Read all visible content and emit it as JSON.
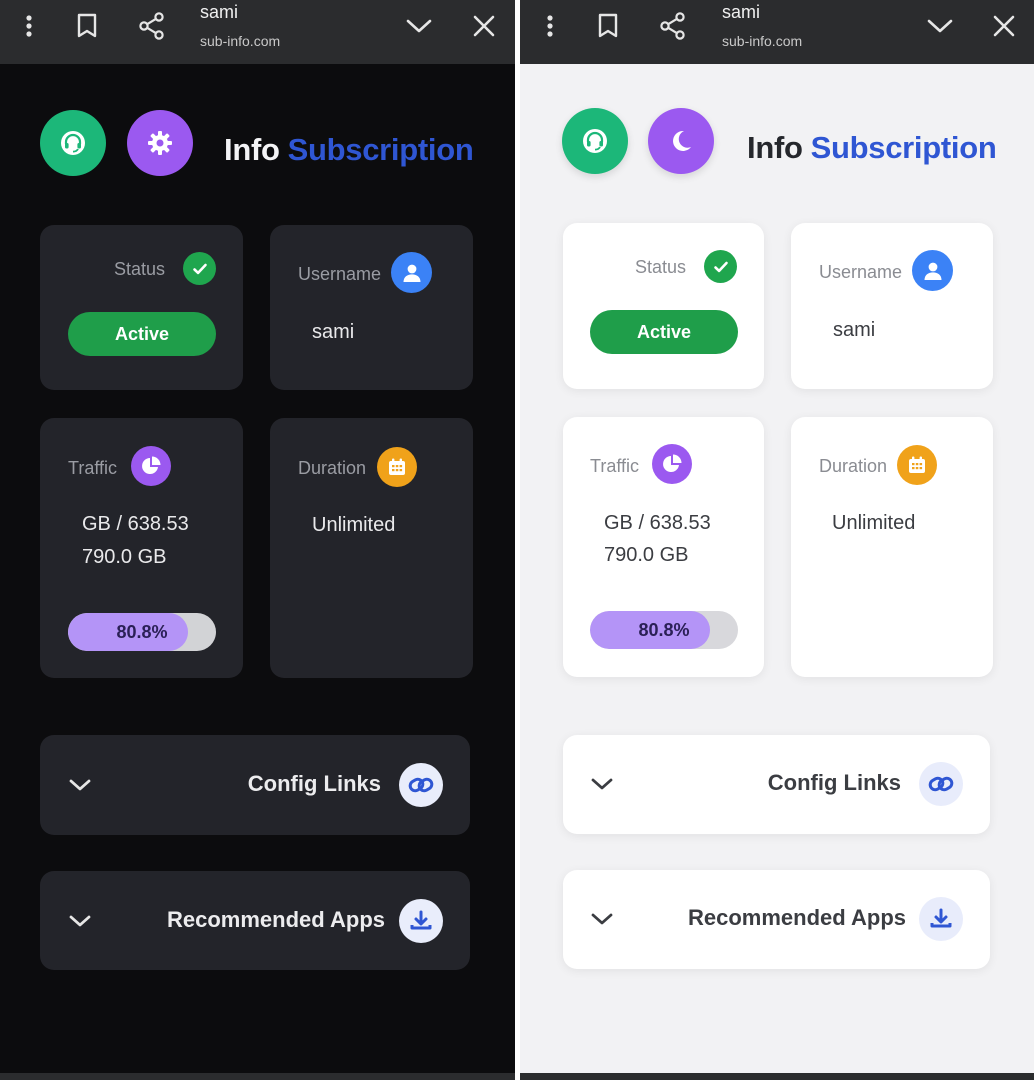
{
  "browser": {
    "title": "sami",
    "url": "sub-info.com"
  },
  "header": {
    "title_word1": "Info",
    "title_word2": "Subscription"
  },
  "status": {
    "label": "Status",
    "value": "Active"
  },
  "username": {
    "label": "Username",
    "value": "sami"
  },
  "traffic": {
    "label": "Traffic",
    "used": "GB / 638.53",
    "total": "790.0 GB",
    "percent_text": "80.8%",
    "percent": 80.8
  },
  "duration": {
    "label": "Duration",
    "value": "Unlimited"
  },
  "sections": {
    "config_links": "Config Links",
    "recommended_apps": "Recommended Apps"
  },
  "icons": {
    "menu": "more-vert-icon",
    "bookmark": "bookmark-icon",
    "share": "share-icon",
    "collapse": "chevron-down-icon",
    "close": "close-icon",
    "support": "headset-icon",
    "settings": "gear-icon",
    "dark_mode": "moon-icon",
    "status": "check-circle-icon",
    "user": "user-icon",
    "traffic": "pie-chart-icon",
    "duration": "calendar-icon",
    "config": "link-icon",
    "apps": "download-icon"
  },
  "colors": {
    "accent_blue": "#2f56d3",
    "green": "#1cb779",
    "purple": "#9b59f0",
    "active_pill": "#1f9e4a",
    "progress_fill": "#b494f7",
    "orange": "#f0a21a",
    "user_blue": "#3b82f6"
  }
}
